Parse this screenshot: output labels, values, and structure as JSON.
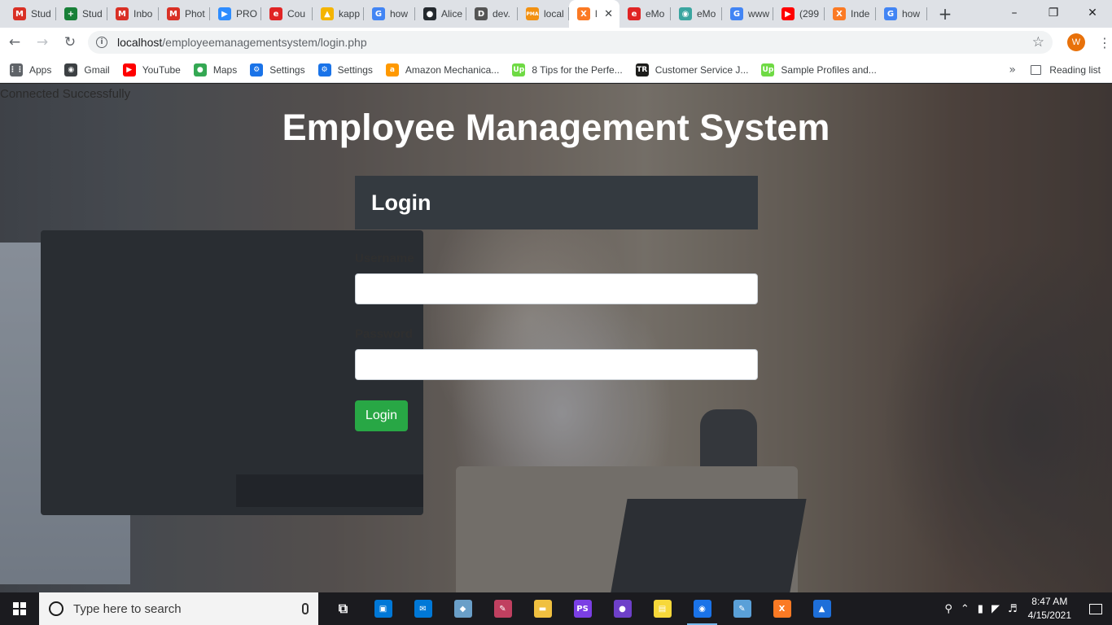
{
  "browser": {
    "tabs": [
      {
        "title": "Stud",
        "icon": "gmail-icon",
        "color": "#d93025",
        "glyph": "M"
      },
      {
        "title": "Stud",
        "icon": "sheets-icon",
        "color": "#188038",
        "glyph": "+"
      },
      {
        "title": "Inbo",
        "icon": "gmail-icon",
        "color": "#d93025",
        "glyph": "M"
      },
      {
        "title": "Phot",
        "icon": "gmail-icon",
        "color": "#d93025",
        "glyph": "M"
      },
      {
        "title": "PRO",
        "icon": "zoom-icon",
        "color": "#2d8cff",
        "glyph": "▶"
      },
      {
        "title": "Cou",
        "icon": "edx-icon",
        "color": "#e02424",
        "glyph": "e"
      },
      {
        "title": "kapp",
        "icon": "drive-icon",
        "color": "#f4b400",
        "glyph": "▲"
      },
      {
        "title": "how",
        "icon": "google-icon",
        "color": "#4285f4",
        "glyph": "G"
      },
      {
        "title": "Alice",
        "icon": "github-icon",
        "color": "#24292e",
        "glyph": "●"
      },
      {
        "title": "dev.",
        "icon": "dev-icon",
        "color": "#555555",
        "glyph": "D"
      },
      {
        "title": "local",
        "icon": "phpmyadmin-icon",
        "color": "#f29111",
        "glyph": "PMA"
      },
      {
        "title": "l",
        "icon": "xampp-icon",
        "color": "#fb7a24",
        "glyph": "X",
        "active": true
      },
      {
        "title": "eMo",
        "icon": "edx-icon",
        "color": "#e02424",
        "glyph": "e"
      },
      {
        "title": "eMo",
        "icon": "globe-icon",
        "color": "#3aa5a0",
        "glyph": "◉"
      },
      {
        "title": "www",
        "icon": "google-icon",
        "color": "#4285f4",
        "glyph": "G"
      },
      {
        "title": "(299",
        "icon": "youtube-icon",
        "color": "#ff0000",
        "glyph": "▶"
      },
      {
        "title": "Inde",
        "icon": "xampp-icon",
        "color": "#fb7a24",
        "glyph": "X"
      },
      {
        "title": "how",
        "icon": "google-icon",
        "color": "#4285f4",
        "glyph": "G"
      }
    ],
    "new_tab_label": "+",
    "url_host": "localhost",
    "url_path": "/employeemanagementsystem/login.php",
    "avatar_letter": "W",
    "bookmarks": [
      {
        "label": "Apps",
        "icon": "apps-grid-icon",
        "color": "#5f6368",
        "glyph": "⋮⋮"
      },
      {
        "label": "Gmail",
        "icon": "globe-icon",
        "color": "#3c4043",
        "glyph": "◉"
      },
      {
        "label": "YouTube",
        "icon": "youtube-icon",
        "color": "#ff0000",
        "glyph": "▶"
      },
      {
        "label": "Maps",
        "icon": "maps-pin-icon",
        "color": "#34a853",
        "glyph": "●"
      },
      {
        "label": "Settings",
        "icon": "settings-gear-icon",
        "color": "#1a73e8",
        "glyph": "⚙"
      },
      {
        "label": "Settings",
        "icon": "settings-gear-icon",
        "color": "#1a73e8",
        "glyph": "⚙"
      },
      {
        "label": "Amazon Mechanica...",
        "icon": "amazon-icon",
        "color": "#ff9900",
        "glyph": "a"
      },
      {
        "label": "8 Tips for the Perfe...",
        "icon": "upwork-icon",
        "color": "#6fda44",
        "glyph": "Up"
      },
      {
        "label": "Customer Service J...",
        "icon": "tr-icon",
        "color": "#1d1d1b",
        "glyph": "TR"
      },
      {
        "label": "Sample Profiles and...",
        "icon": "upwork-icon",
        "color": "#6fda44",
        "glyph": "Up"
      }
    ],
    "more_bookmarks": "»",
    "reading_list": "Reading list"
  },
  "page": {
    "status": "Connected Successfully",
    "heading": "Employee Management System",
    "login_title": "Login",
    "username_label": "Username",
    "password_label": "Password",
    "username_value": "",
    "password_value": "",
    "submit_label": "Login",
    "colors": {
      "header": "#343a40",
      "button": "#28a745"
    }
  },
  "taskbar": {
    "search_placeholder": "Type here to search",
    "apps": [
      {
        "name": "task-view-icon",
        "color": "#ffffff",
        "glyph": "⧉"
      },
      {
        "name": "store-icon",
        "color": "#0078d7",
        "glyph": "▣"
      },
      {
        "name": "mail-icon",
        "color": "#0078d7",
        "glyph": "✉"
      },
      {
        "name": "app-icon",
        "color": "#6a9fc8",
        "glyph": "◆"
      },
      {
        "name": "paint-icon",
        "color": "#c04060",
        "glyph": "✎"
      },
      {
        "name": "file-explorer-icon",
        "color": "#f0c040",
        "glyph": "▬"
      },
      {
        "name": "phpstorm-icon",
        "color": "#7b3fe4",
        "glyph": "PS"
      },
      {
        "name": "github-desktop-icon",
        "color": "#6e40c9",
        "glyph": "●"
      },
      {
        "name": "sticky-notes-icon",
        "color": "#f7d83a",
        "glyph": "▤"
      },
      {
        "name": "chrome-icon",
        "color": "#1a73e8",
        "glyph": "◉",
        "active": true
      },
      {
        "name": "paint-palette-icon",
        "color": "#5aa0d8",
        "glyph": "✎"
      },
      {
        "name": "xampp-icon",
        "color": "#fb7a24",
        "glyph": "X"
      },
      {
        "name": "photos-icon",
        "color": "#1e6fd9",
        "glyph": "▲"
      }
    ],
    "time": "8:47 AM",
    "date": "4/15/2021"
  }
}
